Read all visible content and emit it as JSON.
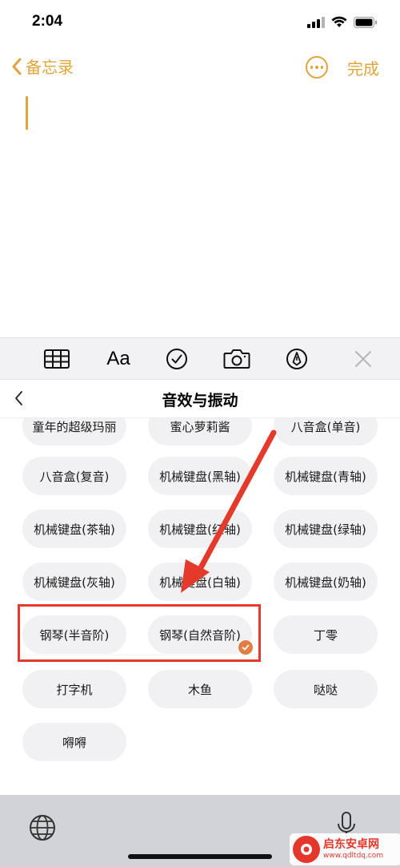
{
  "status": {
    "time": "2:04"
  },
  "nav": {
    "back_label": "备忘录",
    "done_label": "完成"
  },
  "toolbar": {
    "text_format_label": "Aa"
  },
  "panel": {
    "title": "音效与振动"
  },
  "sounds": [
    {
      "label": "童年的超级玛丽"
    },
    {
      "label": "蜜心萝莉酱"
    },
    {
      "label": "八音盒(单音)"
    },
    {
      "label": "八音盒(复音)"
    },
    {
      "label": "机械键盘(黑轴)"
    },
    {
      "label": "机械键盘(青轴)"
    },
    {
      "label": "机械键盘(茶轴)"
    },
    {
      "label": "机械键盘(红轴)"
    },
    {
      "label": "机械键盘(绿轴)"
    },
    {
      "label": "机械键盘(灰轴)"
    },
    {
      "label": "机械键盘(白轴)"
    },
    {
      "label": "机械键盘(奶轴)"
    },
    {
      "label": "钢琴(半音阶)"
    },
    {
      "label": "钢琴(自然音阶)",
      "selected": true
    },
    {
      "label": "丁零"
    },
    {
      "label": "打字机"
    },
    {
      "label": "木鱼"
    },
    {
      "label": "哒哒"
    },
    {
      "label": "嘚嘚"
    }
  ],
  "watermark": {
    "name": "启东安卓网",
    "url": "www.qdltdq.com"
  },
  "colors": {
    "accent": "#e0a53a",
    "annotation": "#e43a2c",
    "selected_badge": "#e07e44"
  }
}
